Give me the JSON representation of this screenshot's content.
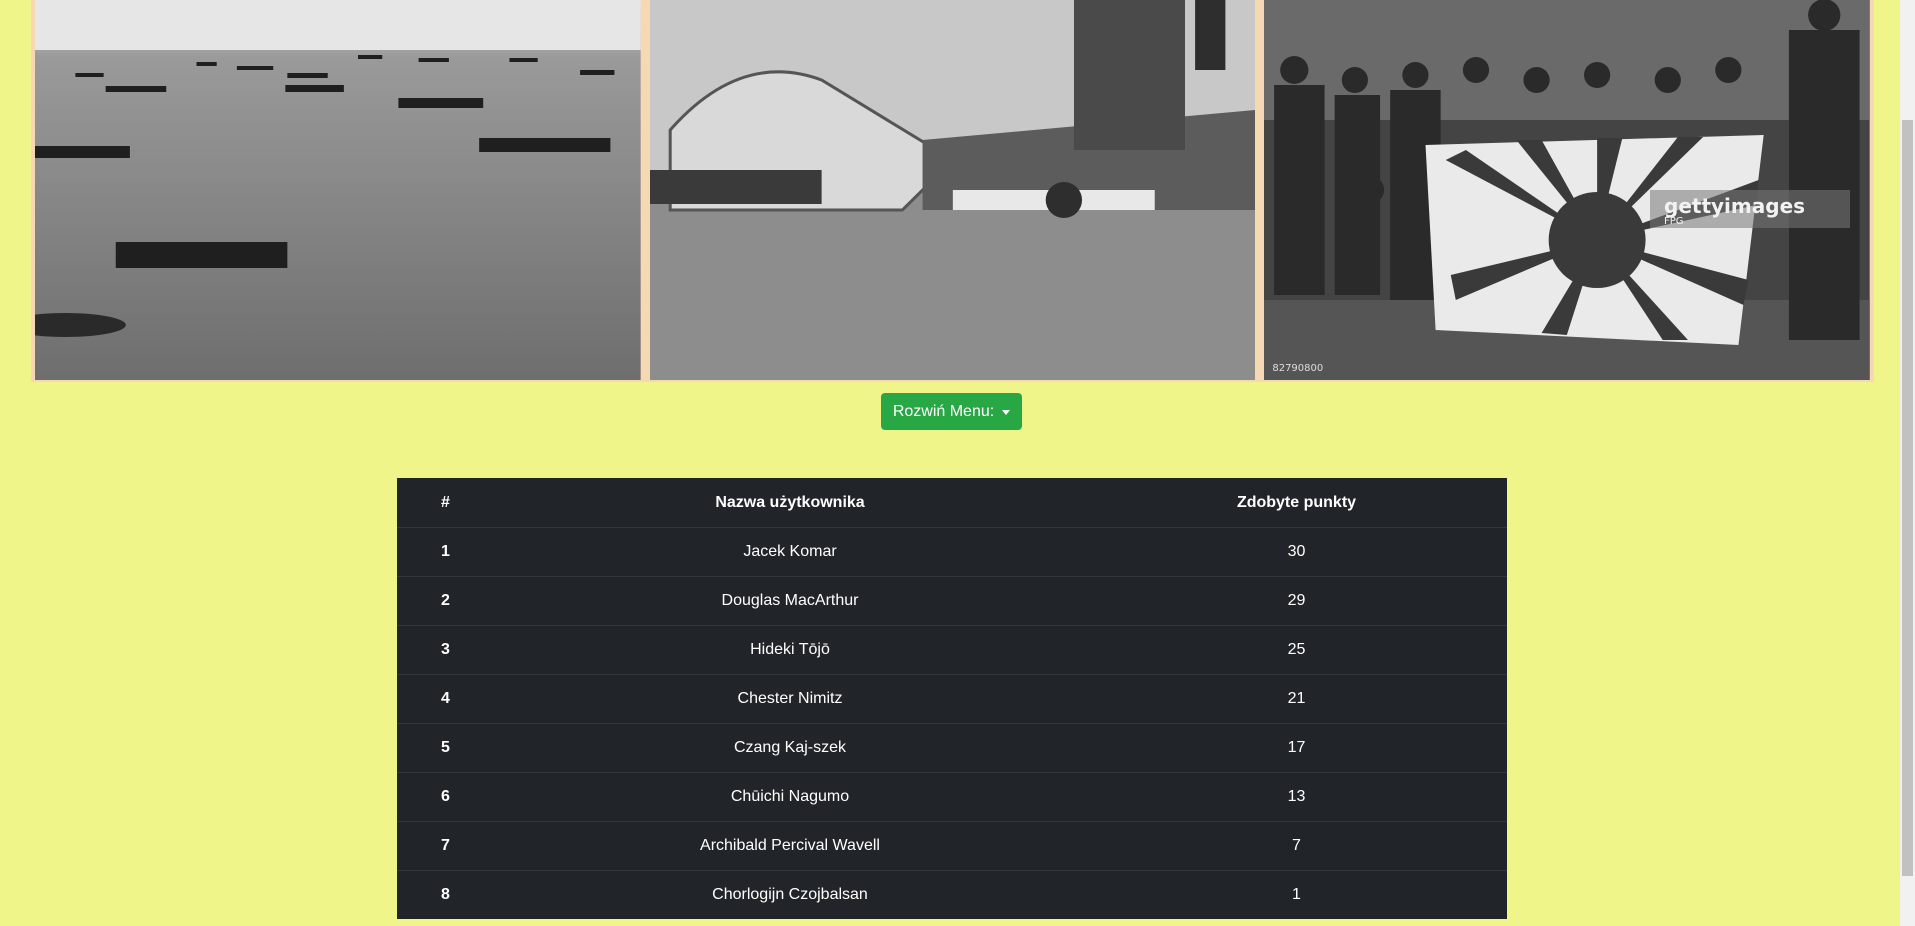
{
  "gallery": {
    "photos": [
      {
        "subject": "fleet-photo"
      },
      {
        "subject": "capsized-ship-photo"
      },
      {
        "subject": "soldiers-flag-photo",
        "watermark_brand": "gettyimages",
        "watermark_credit": "FPG",
        "image_id": "82790800"
      }
    ]
  },
  "menu": {
    "toggle_label": "Rozwiń Menu:"
  },
  "table": {
    "headers": [
      "#",
      "Nazwa użytkownika",
      "Zdobyte punkty"
    ],
    "rows": [
      {
        "rank": "1",
        "user": "Jacek Komar",
        "points": "30"
      },
      {
        "rank": "2",
        "user": "Douglas MacArthur",
        "points": "29"
      },
      {
        "rank": "3",
        "user": "Hideki Tōjō",
        "points": "25"
      },
      {
        "rank": "4",
        "user": "Chester Nimitz",
        "points": "21"
      },
      {
        "rank": "5",
        "user": "Czang Kaj-szek",
        "points": "17"
      },
      {
        "rank": "6",
        "user": "Chūichi Nagumo",
        "points": "13"
      },
      {
        "rank": "7",
        "user": "Archibald Percival Wavell",
        "points": "7"
      },
      {
        "rank": "8",
        "user": "Chorlogijn Czojbalsan",
        "points": "1"
      }
    ]
  },
  "colors": {
    "page_bg": "#f0f58a",
    "button": "#28a745",
    "table_bg": "#212529"
  }
}
